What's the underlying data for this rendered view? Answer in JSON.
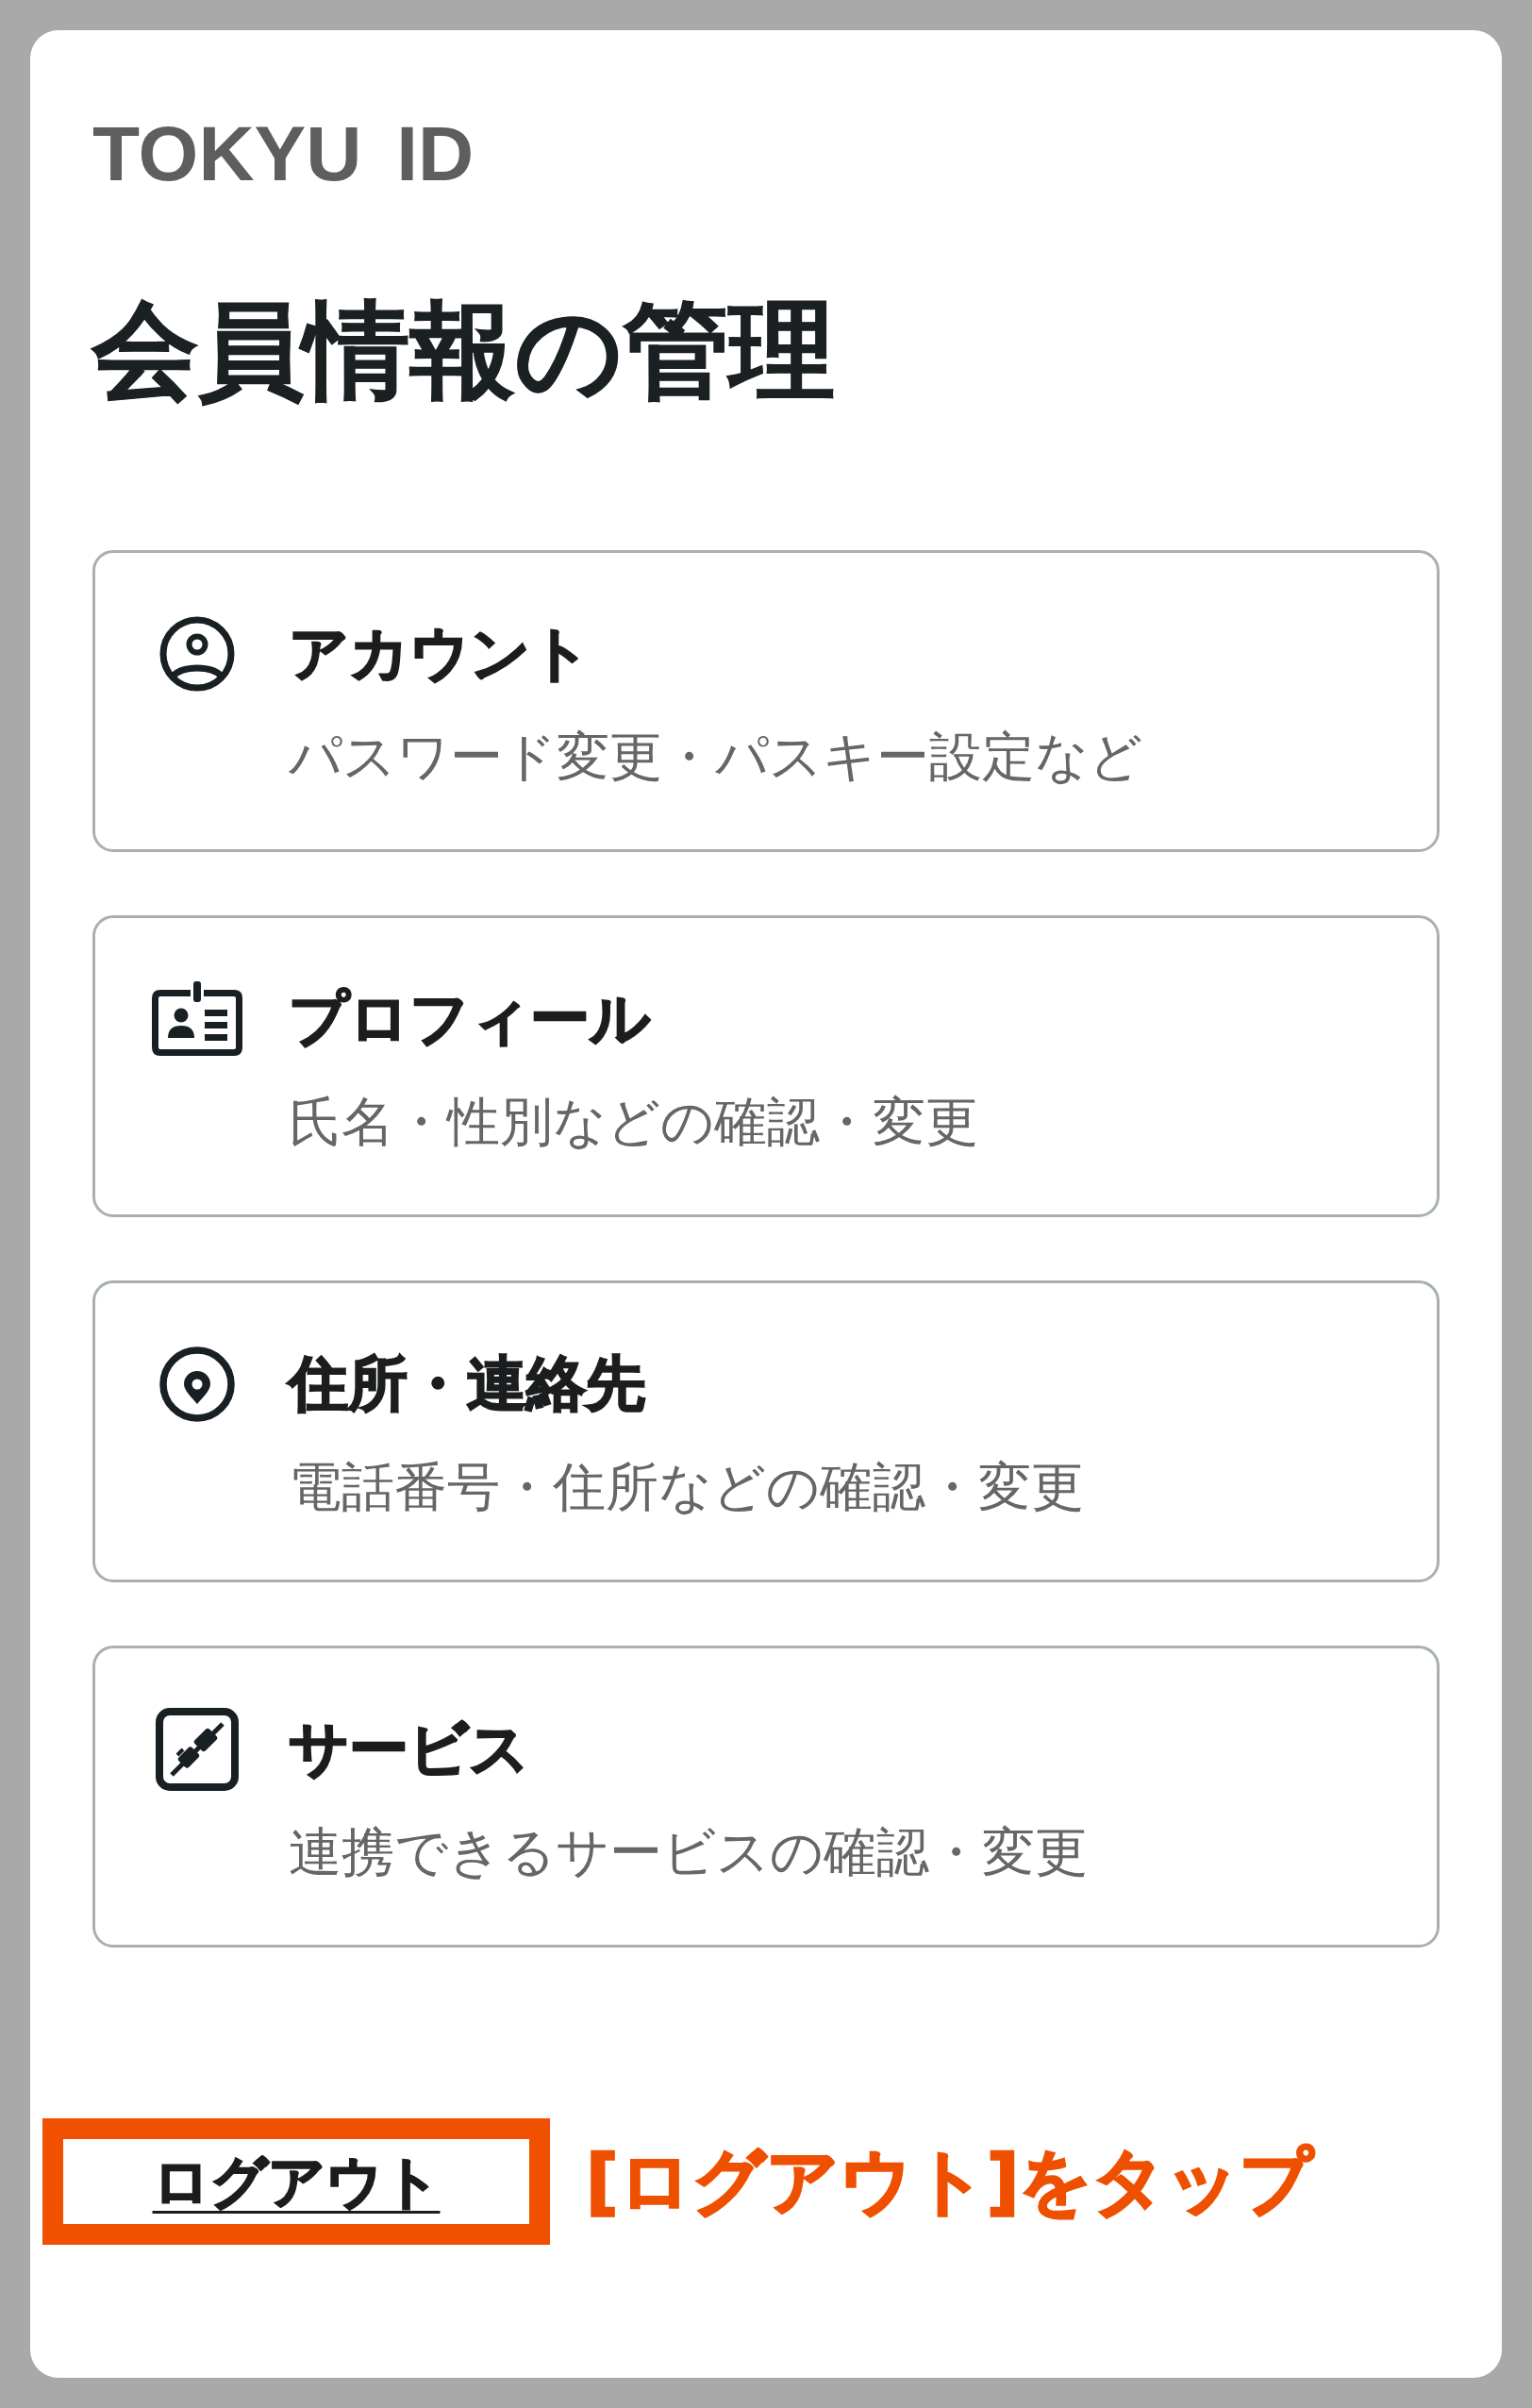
{
  "header": {
    "logo": "TOKYU ID",
    "title": "会員情報の管理"
  },
  "menu": [
    {
      "title": "アカウント",
      "description": "パスワード変更・パスキー設定など"
    },
    {
      "title": "プロフィール",
      "description": "氏名・性別などの確認・変更"
    },
    {
      "title": "住所・連絡先",
      "description": "電話番号・住所などの確認・変更"
    },
    {
      "title": "サービス",
      "description": "連携できるサービスの確認・変更"
    }
  ],
  "logout": {
    "label": "ログアウト",
    "highlighted": true
  },
  "annotation": {
    "text": "[ログアウト]をタップ"
  }
}
